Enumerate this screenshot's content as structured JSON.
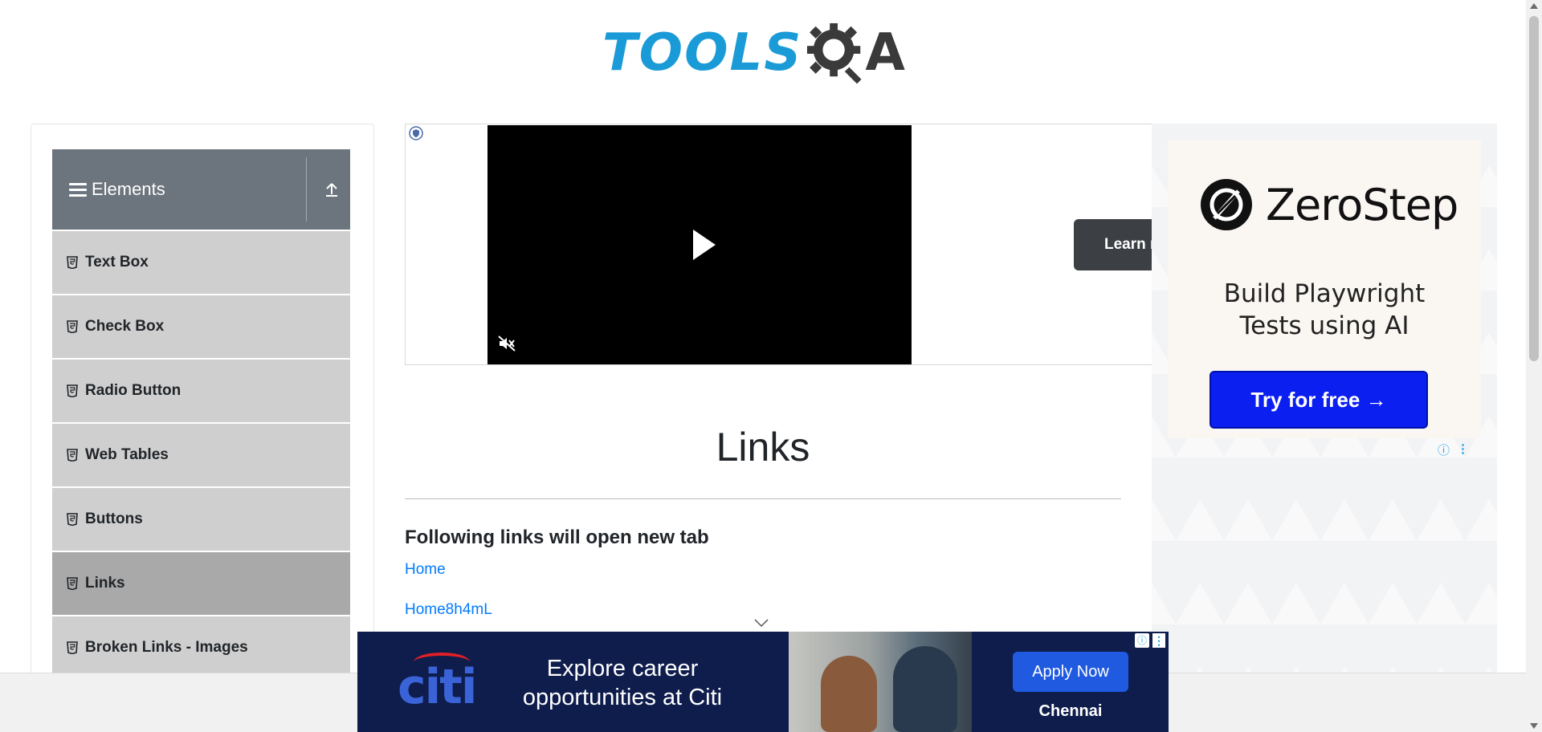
{
  "header": {
    "logo_text": "TOOLS",
    "logo_suffix": "A"
  },
  "sidebar": {
    "group_title": "Elements",
    "items": [
      {
        "label": "Text Box"
      },
      {
        "label": "Check Box"
      },
      {
        "label": "Radio Button"
      },
      {
        "label": "Web Tables"
      },
      {
        "label": "Buttons"
      },
      {
        "label": "Links",
        "active": true
      },
      {
        "label": "Broken Links - Images"
      }
    ]
  },
  "video_ad": {
    "learn_label": "Learn m"
  },
  "side_ad": {
    "brand": "ZeroStep",
    "tagline_line1": "Build Playwright",
    "tagline_line2": "Tests using AI",
    "cta": "Try for free →",
    "accent": "#0b1ff0"
  },
  "main": {
    "title": "Links",
    "subheading": "Following links will open new tab",
    "links": [
      "Home",
      "Home8h4mL"
    ]
  },
  "bottom_ad": {
    "brand": "citi",
    "headline_line1": "Explore career",
    "headline_line2": "opportunities at Citi",
    "cta": "Apply Now",
    "location": "Chennai"
  }
}
